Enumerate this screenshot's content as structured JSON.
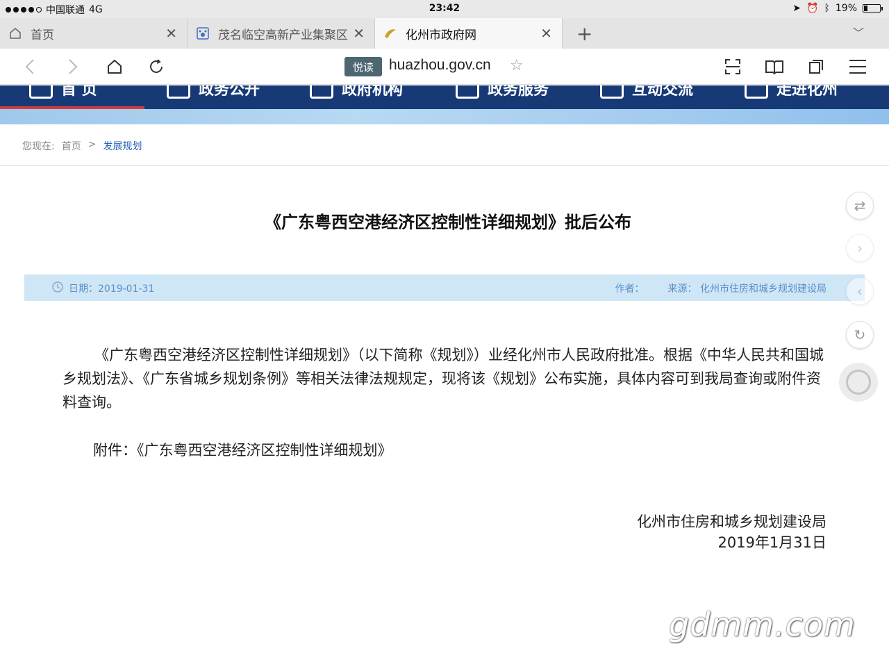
{
  "status_bar": {
    "carrier": "中国联通",
    "network": "4G",
    "time": "23:42",
    "battery": "19%",
    "battery_level": 0.19
  },
  "tabs": [
    {
      "label": "首页",
      "icon": "home-icon",
      "active": false
    },
    {
      "label": "茂名临空高新产业集聚区",
      "icon": "paw-icon",
      "active": false
    },
    {
      "label": "化州市政府网",
      "icon": "site-logo-icon",
      "active": true
    }
  ],
  "address_bar": {
    "read_mode_label": "悦读",
    "url": "huazhou.gov.cn"
  },
  "site_nav": {
    "items": [
      "首 页",
      "政务公开",
      "政府机构",
      "政务服务",
      "互动交流",
      "走进化州"
    ]
  },
  "breadcrumb": {
    "prefix": "您现在:",
    "home": "首页",
    "separator": ">",
    "current": "发展规划"
  },
  "article": {
    "title": "《广东粤西空港经济区控制性详细规划》批后公布",
    "meta": {
      "date": "日期：2019-01-31",
      "author": "作者：",
      "source": "来源：  化州市住房和城乡规划建设局"
    },
    "body": "《广东粤西空港经济区控制性详细规划》（以下简称《规划》）业经化州市人民政府批准。根据《中华人民共和国城乡规划法》、《广东省城乡规划条例》等相关法律法规规定，现将该《规划》公布实施，具体内容可到我局查询或附件资料查询。",
    "attachment": "附件：《广东粤西空港经济区控制性详细规划》",
    "signature_org": "化州市住房和城乡规划建设局",
    "signature_date": "2019年1月31日"
  },
  "watermark": "gdmm.com"
}
